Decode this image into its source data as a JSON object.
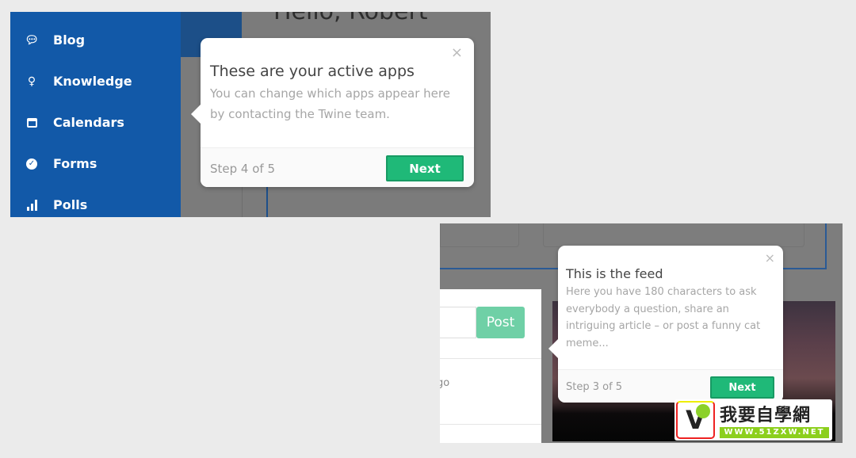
{
  "panel1": {
    "greeting": "Hello, Robert",
    "sidebar": {
      "items": [
        {
          "label": "Blog",
          "icon": "speech-bubble-icon"
        },
        {
          "label": "Knowledge",
          "icon": "lightbulb-icon"
        },
        {
          "label": "Calendars",
          "icon": "calendar-icon"
        },
        {
          "label": "Forms",
          "icon": "check-circle-icon"
        },
        {
          "label": "Polls",
          "icon": "bar-chart-icon"
        }
      ]
    },
    "tooltip": {
      "title": "These are your active apps",
      "body": "You can change which apps appear here by contacting the Twine team.",
      "step": "Step 4 of 5",
      "next_label": "Next",
      "close": "×"
    }
  },
  "panel2": {
    "post_label": "Post",
    "feed_snippet": "go",
    "tooltip": {
      "title": "This is the feed",
      "body": "Here you have 180 characters to ask everybody a question, share an intriguing article – or post a funny cat meme...",
      "step": "Step 3 of 5",
      "next_label": "Next",
      "close": "×"
    }
  },
  "watermark": {
    "text": "我要自學網",
    "url": "WWW.51ZXW.NET"
  },
  "colors": {
    "sidebar": "#1259a8",
    "accent": "#1fb978",
    "post": "#6fd0a6"
  }
}
